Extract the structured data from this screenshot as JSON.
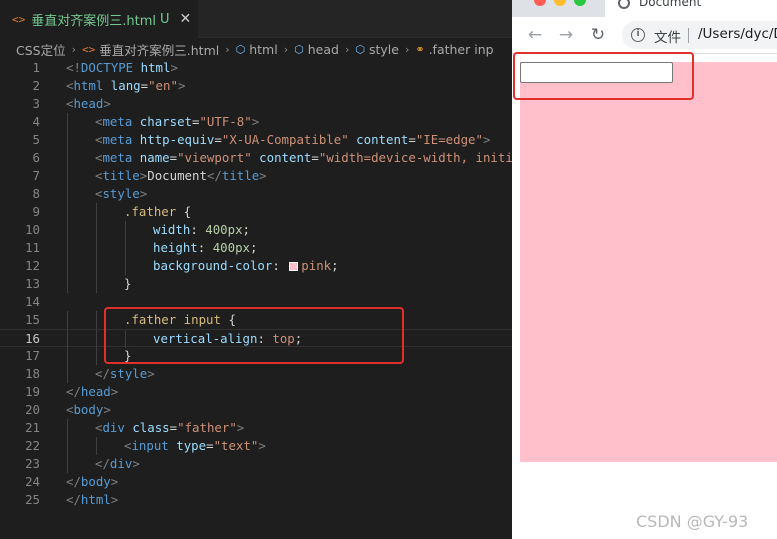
{
  "editor": {
    "tab": {
      "icon": "html-file-icon",
      "title": "垂直对齐案例三.html",
      "status": "U",
      "close_glyph": "✕"
    },
    "breadcrumb": {
      "items": [
        "CSS定位",
        "垂直对齐案例三.html",
        "html",
        "head",
        "style",
        ".father inp"
      ],
      "separator": "›"
    },
    "active_line": 16,
    "lines": [
      {
        "n": "1",
        "indent": 0,
        "tokens": [
          [
            "br",
            "<!"
          ],
          [
            "tag",
            "DOCTYPE"
          ],
          [
            "txt",
            " "
          ],
          [
            "attr",
            "html"
          ],
          [
            "br",
            ">"
          ]
        ]
      },
      {
        "n": "2",
        "indent": 0,
        "tokens": [
          [
            "br",
            "<"
          ],
          [
            "tag",
            "html"
          ],
          [
            "txt",
            " "
          ],
          [
            "attr",
            "lang"
          ],
          [
            "txt",
            "="
          ],
          [
            "str",
            "\"en\""
          ],
          [
            "br",
            ">"
          ]
        ]
      },
      {
        "n": "3",
        "indent": 0,
        "tokens": [
          [
            "br",
            "<"
          ],
          [
            "tag",
            "head"
          ],
          [
            "br",
            ">"
          ]
        ]
      },
      {
        "n": "4",
        "indent": 1,
        "tokens": [
          [
            "br",
            "<"
          ],
          [
            "tag",
            "meta"
          ],
          [
            "txt",
            " "
          ],
          [
            "attr",
            "charset"
          ],
          [
            "txt",
            "="
          ],
          [
            "str",
            "\"UTF-8\""
          ],
          [
            "br",
            ">"
          ]
        ]
      },
      {
        "n": "5",
        "indent": 1,
        "tokens": [
          [
            "br",
            "<"
          ],
          [
            "tag",
            "meta"
          ],
          [
            "txt",
            " "
          ],
          [
            "attr",
            "http-equiv"
          ],
          [
            "txt",
            "="
          ],
          [
            "str",
            "\"X-UA-Compatible\""
          ],
          [
            "txt",
            " "
          ],
          [
            "attr",
            "content"
          ],
          [
            "txt",
            "="
          ],
          [
            "str",
            "\"IE=edge\""
          ],
          [
            "br",
            ">"
          ]
        ]
      },
      {
        "n": "6",
        "indent": 1,
        "tokens": [
          [
            "br",
            "<"
          ],
          [
            "tag",
            "meta"
          ],
          [
            "txt",
            " "
          ],
          [
            "attr",
            "name"
          ],
          [
            "txt",
            "="
          ],
          [
            "str",
            "\"viewport\""
          ],
          [
            "txt",
            " "
          ],
          [
            "attr",
            "content"
          ],
          [
            "txt",
            "="
          ],
          [
            "str",
            "\"width=device-width, initial"
          ]
        ]
      },
      {
        "n": "7",
        "indent": 1,
        "tokens": [
          [
            "br",
            "<"
          ],
          [
            "tag",
            "title"
          ],
          [
            "br",
            ">"
          ],
          [
            "txt",
            "Document"
          ],
          [
            "br",
            "</"
          ],
          [
            "tag",
            "title"
          ],
          [
            "br",
            ">"
          ]
        ]
      },
      {
        "n": "8",
        "indent": 1,
        "tokens": [
          [
            "br",
            "<"
          ],
          [
            "tag",
            "style"
          ],
          [
            "br",
            ">"
          ]
        ]
      },
      {
        "n": "9",
        "indent": 2,
        "tokens": [
          [
            "sel",
            ".father"
          ],
          [
            "txt",
            " {"
          ]
        ]
      },
      {
        "n": "10",
        "indent": 3,
        "tokens": [
          [
            "prop",
            "width"
          ],
          [
            "txt",
            ": "
          ],
          [
            "num",
            "400px"
          ],
          [
            "txt",
            ";"
          ]
        ]
      },
      {
        "n": "11",
        "indent": 3,
        "tokens": [
          [
            "prop",
            "height"
          ],
          [
            "txt",
            ": "
          ],
          [
            "num",
            "400px"
          ],
          [
            "txt",
            ";"
          ]
        ]
      },
      {
        "n": "12",
        "indent": 3,
        "tokens": [
          [
            "prop",
            "background-color"
          ],
          [
            "txt",
            ": "
          ],
          [
            "swatch",
            "#ffc0cb"
          ],
          [
            "val",
            "pink"
          ],
          [
            "txt",
            ";"
          ]
        ]
      },
      {
        "n": "13",
        "indent": 2,
        "tokens": [
          [
            "txt",
            "}"
          ]
        ]
      },
      {
        "n": "14",
        "indent": 0,
        "tokens": []
      },
      {
        "n": "15",
        "indent": 2,
        "tokens": [
          [
            "sel",
            ".father input"
          ],
          [
            "txt",
            " {"
          ]
        ]
      },
      {
        "n": "16",
        "indent": 3,
        "tokens": [
          [
            "prop",
            "vertical-align"
          ],
          [
            "txt",
            ": "
          ],
          [
            "val",
            "top"
          ],
          [
            "txt",
            ";"
          ]
        ]
      },
      {
        "n": "17",
        "indent": 2,
        "tokens": [
          [
            "txt",
            "}"
          ]
        ]
      },
      {
        "n": "18",
        "indent": 1,
        "tokens": [
          [
            "br",
            "</"
          ],
          [
            "tag",
            "style"
          ],
          [
            "br",
            ">"
          ]
        ]
      },
      {
        "n": "19",
        "indent": 0,
        "tokens": [
          [
            "br",
            "</"
          ],
          [
            "tag",
            "head"
          ],
          [
            "br",
            ">"
          ]
        ]
      },
      {
        "n": "20",
        "indent": 0,
        "tokens": [
          [
            "br",
            "<"
          ],
          [
            "tag",
            "body"
          ],
          [
            "br",
            ">"
          ]
        ]
      },
      {
        "n": "21",
        "indent": 1,
        "tokens": [
          [
            "br",
            "<"
          ],
          [
            "tag",
            "div"
          ],
          [
            "txt",
            " "
          ],
          [
            "attr",
            "class"
          ],
          [
            "txt",
            "="
          ],
          [
            "str",
            "\"father\""
          ],
          [
            "br",
            ">"
          ]
        ]
      },
      {
        "n": "22",
        "indent": 2,
        "tokens": [
          [
            "br",
            "<"
          ],
          [
            "tag",
            "input"
          ],
          [
            "txt",
            " "
          ],
          [
            "attr",
            "type"
          ],
          [
            "txt",
            "="
          ],
          [
            "str",
            "\"text\""
          ],
          [
            "br",
            ">"
          ]
        ]
      },
      {
        "n": "23",
        "indent": 1,
        "tokens": [
          [
            "br",
            "</"
          ],
          [
            "tag",
            "div"
          ],
          [
            "br",
            ">"
          ]
        ]
      },
      {
        "n": "24",
        "indent": 0,
        "tokens": [
          [
            "br",
            "</"
          ],
          [
            "tag",
            "body"
          ],
          [
            "br",
            ">"
          ]
        ]
      },
      {
        "n": "25",
        "indent": 0,
        "tokens": [
          [
            "br",
            "</"
          ],
          [
            "tag",
            "html"
          ],
          [
            "br",
            ">"
          ]
        ]
      }
    ]
  },
  "browser": {
    "tab_title": "Document",
    "tab_icon": "globe-icon",
    "nav": {
      "back": "←",
      "forward": "→",
      "reload": "↻"
    },
    "omnibox": {
      "info_glyph": "i",
      "label": "文件",
      "url": "/Users/dyc/D"
    },
    "traffic_colors": [
      "#ff5f57",
      "#febc2e",
      "#28c840"
    ]
  },
  "colors": {
    "pink": "#ffc0cb",
    "highlight_box": "#e0302c"
  },
  "watermark": "CSDN @GY-93"
}
